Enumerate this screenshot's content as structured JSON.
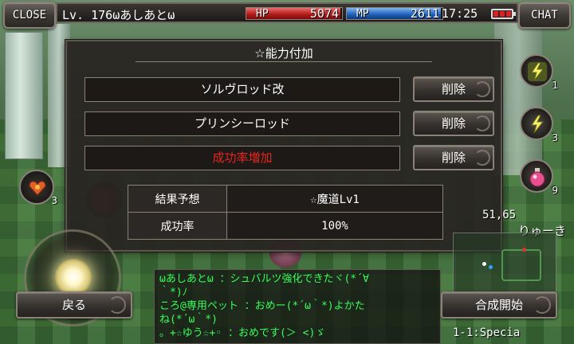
{
  "hud": {
    "close_label": "CLOSE",
    "chat_label": "CHAT",
    "level_text": "Lv. 176ωあしあとω",
    "hp_label": "HP",
    "hp_value": "5074",
    "hp_fill_fraction": 0.98,
    "mp_label": "MP",
    "mp_value": "2611",
    "mp_fill_fraction": 0.98,
    "time": "17:25",
    "battery_level": "low",
    "colors": {
      "hp": "#b01818",
      "mp": "#1e5fb8",
      "battery": "#e02020"
    }
  },
  "dialog": {
    "title": "☆能力付加",
    "slots": [
      {
        "text": "ソルヴロッド改",
        "color": "white",
        "delete_label": "削除"
      },
      {
        "text": "プリンシーロッド",
        "color": "white",
        "delete_label": "削除"
      },
      {
        "text": "成功率増加",
        "color": "red",
        "delete_label": "削除"
      }
    ],
    "results": [
      {
        "key": "結果予想",
        "value": "☆魔道Lv1"
      },
      {
        "key": "成功率",
        "value": "100%"
      }
    ]
  },
  "skills": [
    {
      "icon": "lightning-skill-icon",
      "count": "1"
    },
    {
      "icon": "lightning-skill-icon",
      "count": "3"
    },
    {
      "icon": "potion-icon",
      "count": "9"
    }
  ],
  "left_item": {
    "icon": "heart-gem-icon",
    "count": "3"
  },
  "coords_text": "51,65",
  "player_name": "りゅーき",
  "buttons": {
    "back_label": "戻る",
    "synth_label": "合成開始"
  },
  "chat_lines": [
    "ωあしあとω ：シュバルツ強化できたヾ(*´∀",
    " ｀*)ﾉ",
    "ころ@専用ペット ：おめー(*´ω｀*)よかた",
    " ね(*´ω｀*)",
    "。+☆ゆう☆+◦ ：おめです(＞ <)ゞ"
  ],
  "area_label": "1-1:Specia"
}
